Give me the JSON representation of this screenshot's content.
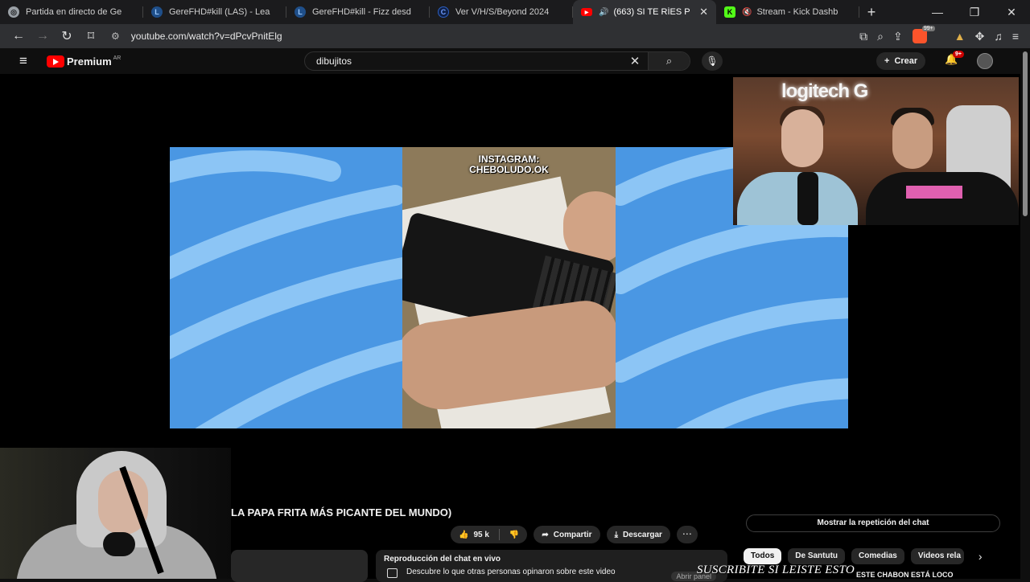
{
  "browser": {
    "tabs": [
      {
        "label": "Partida en directo de Ge",
        "icon": "globe-icon",
        "color": "#9aa0a6",
        "active": false
      },
      {
        "label": "GereFHD#kill (LAS) - Lea",
        "icon": "league-icon",
        "color": "#3a7bd5",
        "active": false
      },
      {
        "label": "GereFHD#kill - Fizz desd",
        "icon": "league-icon",
        "color": "#3a7bd5",
        "active": false
      },
      {
        "label": "Ver V/H/S/Beyond 2024",
        "icon": "c-logo-icon",
        "color": "#2d5fc1",
        "active": false
      },
      {
        "label": "(663) SI TE RÍES P",
        "icon": "youtube-icon",
        "color": "#ff0000",
        "active": true
      },
      {
        "label": "Stream - Kick Dashb",
        "icon": "kick-icon",
        "color": "#53fc18",
        "active": false
      }
    ],
    "url": "youtube.com/watch?v=dPcvPnitElg",
    "brave_badge": "99+"
  },
  "youtube": {
    "brand": "Premium",
    "country": "AR",
    "search_value": "dibujitos",
    "create_label": "Crear",
    "notifications": "9+"
  },
  "video": {
    "overlay_text": "INSTAGRAM:\nCHEBOLUDO.OK",
    "title": "LA PAPA FRITA MÁS PICANTE DEL MUNDO)",
    "likes": "95 k",
    "share_label": "Compartir",
    "download_label": "Descargar"
  },
  "chat": {
    "header": "Reproducción del chat en vivo",
    "subtitle": "Descubre lo que otras personas opinaron sobre este video",
    "open_label": "Abrir panel",
    "replay_button": "Mostrar la repetición del chat"
  },
  "chips": [
    "Todos",
    "De Santutu",
    "Comedias",
    "Videos rela"
  ],
  "stream_overlay": "SUSCRIBITE SI LEISTE ESTO",
  "next_video": "ESTE CHABON ESTÁ LOCO",
  "webcam_sign": "logitech G"
}
